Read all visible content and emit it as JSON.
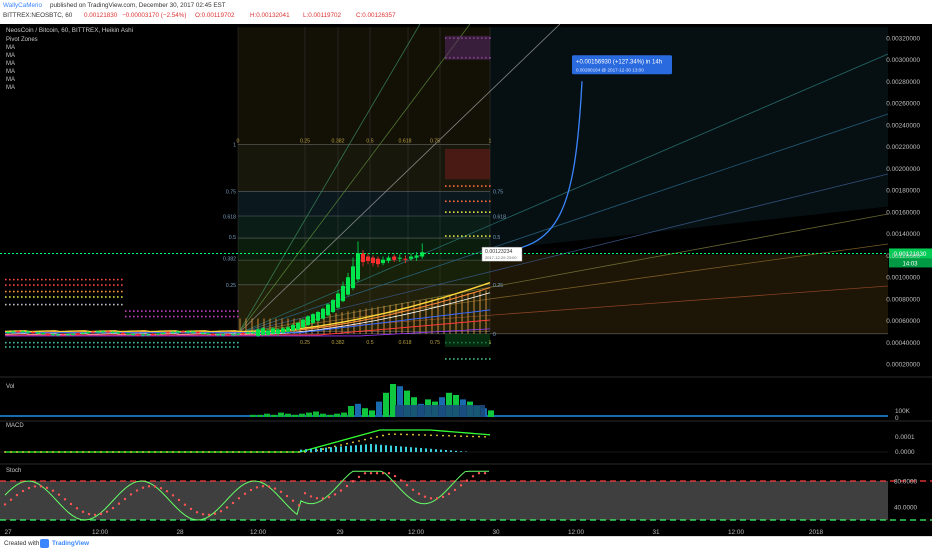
{
  "header": {
    "author": "WallyCaMerio",
    "published_line": "published on TradingView.com, December 30, 2017 02:45 EST",
    "symbol_line": "BITTREX:NEOSBTC, 60",
    "open": "O:0.00119702",
    "high": "H:0.00132041",
    "low": "L:0.00119702",
    "close": "C:0.00126357",
    "last": "0.00121830",
    "change": "−0.00003170 (−2.54%)"
  },
  "legend": {
    "title": "NeosCoin / Bitcoin, 60, BITTREX, Heikin Ashi",
    "items": [
      "Pivot Zones",
      "MA",
      "MA",
      "MA",
      "MA",
      "MA",
      "MA"
    ]
  },
  "footer": {
    "created_with": "Created with",
    "brand": "TradingView"
  },
  "colors": {
    "background": "#000000",
    "up_candle": "#00e64d",
    "down_candle": "#ff2d2d",
    "price_line": "#00ff66",
    "projection": "#3a86ff",
    "macd": "#33ff33",
    "stoch_k": "#66ff66",
    "stoch_d": "#ff5555"
  },
  "chart_data": {
    "type": "candlestick",
    "price_axis": {
      "ticks": [
        "0.00320000",
        "0.00300000",
        "0.00280000",
        "0.00260000",
        "0.00240000",
        "0.00220000",
        "0.00200000",
        "0.00180000",
        "0.00160000",
        "0.00140000",
        "0.00120000",
        "0.00100000",
        "0.00080000",
        "0.00060000",
        "0.00040000",
        "0.00020000"
      ],
      "ylim": [
        0.00011,
        0.00331
      ]
    },
    "time_axis": {
      "labels": [
        "27",
        "12:00",
        "28",
        "12:00",
        "29",
        "12:00",
        "30",
        "12:00",
        "31",
        "12:00",
        "2018"
      ]
    },
    "last_price": {
      "label": "0.00121830",
      "countdown": "14:03",
      "value": 0.0012183
    },
    "crosshair_label": {
      "value": "0.00123234",
      "time": "2017-12-29 23:00"
    },
    "projection": {
      "label": "+0.00156930 (+127.34%) in 14h",
      "sub": "0.00280164 @ 2017-12-30 13:00",
      "target": 0.00280164
    },
    "fib_retracement": {
      "levels": [
        "0",
        "0.25",
        "0.382",
        "0.5",
        "0.618",
        "0.75",
        "1"
      ],
      "low": 0.0005,
      "high": 0.00222
    },
    "fib_top_labels": [
      "0",
      "0.25",
      "0.382",
      "0.5",
      "0.618",
      "0.75",
      "1"
    ],
    "fib_side_labels": [
      "1",
      "0.75",
      "0.618",
      "0.5",
      "0.382",
      "0.25",
      "0"
    ],
    "fib_right_labels": [
      "0.75",
      "0.618",
      "0.5",
      "0.382",
      "0.25",
      "0"
    ],
    "fib_bottom_labels": [
      "0.25",
      "0.382",
      "0.5",
      "0.618",
      "0.75",
      "1"
    ],
    "candles": {
      "up": [
        [
          0.00046,
          0.00052,
          0.00045,
          0.00053
        ],
        [
          0.00047,
          0.00053,
          0.00046,
          0.00054
        ],
        [
          0.00047,
          0.00051,
          0.00046,
          0.00053
        ],
        [
          0.00048,
          0.00053,
          0.00047,
          0.00054
        ],
        [
          0.00048,
          0.00052,
          0.00046,
          0.00053
        ],
        [
          0.00049,
          0.00053,
          0.00048,
          0.00054
        ],
        [
          0.0005,
          0.00054,
          0.00049,
          0.00055
        ],
        [
          0.00051,
          0.00056,
          0.0005,
          0.00057
        ],
        [
          0.00052,
          0.00058,
          0.00051,
          0.00059
        ],
        [
          0.00054,
          0.00061,
          0.00053,
          0.00062
        ],
        [
          0.00056,
          0.00064,
          0.00055,
          0.00065
        ],
        [
          0.00058,
          0.00066,
          0.00057,
          0.00067
        ],
        [
          0.0006,
          0.00068,
          0.00059,
          0.00069
        ],
        [
          0.00062,
          0.00071,
          0.00061,
          0.00072
        ],
        [
          0.00065,
          0.00075,
          0.00064,
          0.00076
        ],
        [
          0.00068,
          0.00079,
          0.00067,
          0.0008
        ],
        [
          0.00072,
          0.00085,
          0.00071,
          0.00088
        ],
        [
          0.00078,
          0.00092,
          0.00077,
          0.00096
        ],
        [
          0.00084,
          0.001,
          0.00083,
          0.00104
        ],
        [
          0.0009,
          0.0011,
          0.00088,
          0.00118
        ],
        [
          0.00098,
          0.00122,
          0.00096,
          0.00133
        ]
      ],
      "down": [
        [
          0.00122,
          0.00114,
          0.0011,
          0.00125
        ],
        [
          0.00119,
          0.00115,
          0.00112,
          0.00122
        ],
        [
          0.00118,
          0.00113,
          0.0011,
          0.0012
        ],
        [
          0.00117,
          0.00112,
          0.00109,
          0.00119
        ]
      ],
      "late": [
        [
          0.00113,
          0.00116,
          0.00111,
          0.00119
        ],
        [
          0.00115,
          0.00118,
          0.00113,
          0.0012
        ],
        [
          0.00116,
          0.00119,
          0.00114,
          0.00121
        ],
        [
          0.00117,
          0.00118,
          0.00114,
          0.00121
        ],
        [
          0.00116,
          0.00117,
          0.00113,
          0.0012
        ],
        [
          0.00117,
          0.00119,
          0.00115,
          0.00122
        ],
        [
          0.00118,
          0.0012,
          0.00115,
          0.00123
        ],
        [
          0.00119,
          0.00123,
          0.00117,
          0.00131
        ]
      ]
    },
    "volume": {
      "label": "Vol",
      "ticks": [
        "100K",
        "0"
      ],
      "bars": [
        2,
        2,
        3,
        2,
        4,
        3,
        2,
        3,
        4,
        5,
        3,
        2,
        3,
        4,
        10,
        12,
        8,
        6,
        14,
        22,
        30,
        28,
        24,
        18,
        12,
        16,
        14,
        18,
        22,
        20,
        16,
        14,
        10,
        8,
        6
      ]
    },
    "macd": {
      "label": "MACD",
      "ticks": [
        "0.0001",
        "0.0000"
      ]
    },
    "stoch": {
      "label": "Stoch",
      "ticks": [
        "80.0000",
        "40.0000"
      ]
    }
  }
}
